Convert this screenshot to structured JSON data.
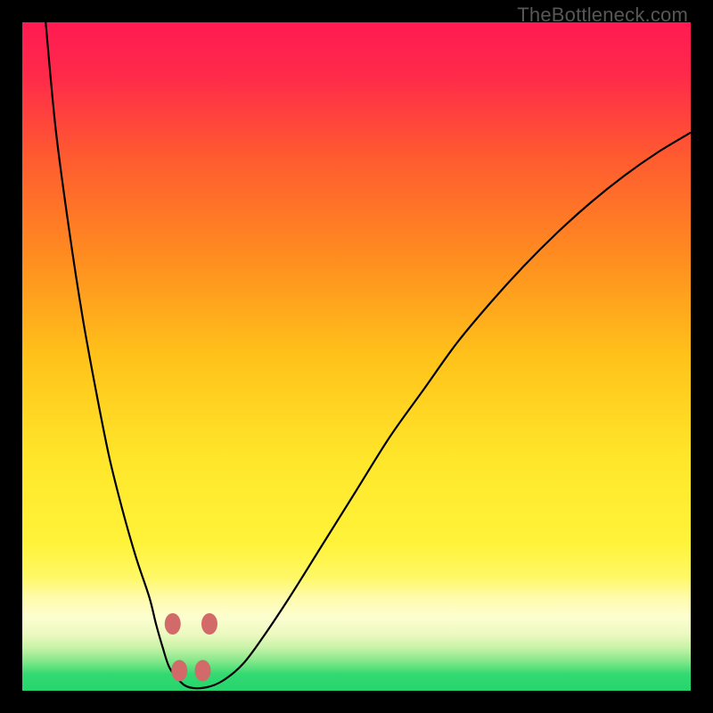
{
  "watermark": "TheBottleneck.com",
  "colors": {
    "black": "#000000",
    "watermark_text": "#575757",
    "curve": "#000000",
    "marker": "#d36a6a"
  },
  "gradient": {
    "direction": "vertical",
    "stops": [
      {
        "offset": 0.0,
        "color": "#ff1a52"
      },
      {
        "offset": 0.08,
        "color": "#ff2a4a"
      },
      {
        "offset": 0.2,
        "color": "#ff5a30"
      },
      {
        "offset": 0.35,
        "color": "#ff8c20"
      },
      {
        "offset": 0.5,
        "color": "#ffc21a"
      },
      {
        "offset": 0.65,
        "color": "#ffe62a"
      },
      {
        "offset": 0.78,
        "color": "#fff33a"
      },
      {
        "offset": 0.83,
        "color": "#fff866"
      },
      {
        "offset": 0.86,
        "color": "#fffbaa"
      },
      {
        "offset": 0.89,
        "color": "#fdfed0"
      },
      {
        "offset": 0.915,
        "color": "#ecf9c0"
      },
      {
        "offset": 0.935,
        "color": "#c9f3a8"
      },
      {
        "offset": 0.955,
        "color": "#87e88a"
      },
      {
        "offset": 0.975,
        "color": "#34d972"
      },
      {
        "offset": 1.0,
        "color": "#25d56c"
      }
    ]
  },
  "chart_data": {
    "type": "line",
    "title": "",
    "xlabel": "",
    "ylabel": "",
    "xlim": [
      0,
      100
    ],
    "ylim": [
      0,
      100
    ],
    "x": [
      3.5,
      5,
      7,
      9,
      11,
      13,
      15,
      17,
      19,
      20,
      21,
      22,
      23.5,
      25,
      27.5,
      30,
      33,
      36,
      40,
      45,
      50,
      55,
      60,
      65,
      70,
      75,
      80,
      85,
      90,
      95,
      100
    ],
    "values": [
      100,
      84,
      69,
      56,
      45,
      35,
      27,
      20,
      14,
      10,
      6.5,
      3.5,
      1.5,
      0.5,
      0.5,
      1.5,
      4,
      8,
      14,
      22,
      30,
      38,
      45,
      52,
      58,
      63.5,
      68.5,
      73,
      77,
      80.5,
      83.5
    ],
    "minimum_region_x": [
      22.5,
      28
    ],
    "markers": [
      {
        "x": 22.5,
        "y": 10.0
      },
      {
        "x": 23.5,
        "y": 3.0
      },
      {
        "x": 27.0,
        "y": 3.0
      },
      {
        "x": 28.0,
        "y": 10.0
      }
    ]
  }
}
